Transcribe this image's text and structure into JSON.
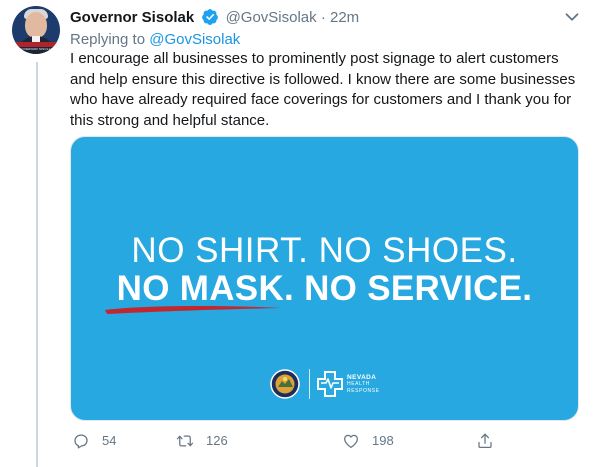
{
  "tweet": {
    "author_name": "Governor Sisolak",
    "author_handle": "@GovSisolak",
    "separator": "·",
    "time": "22m",
    "reply_prefix": "Replying to",
    "reply_to": "@GovSisolak",
    "text": "I encourage all businesses to prominently post signage to alert customers and help ensure this directive is followed. I know there are some businesses who have already required face coverings for customers and I thank you for this strong and helpful stance.",
    "avatar_ribbon_text": "GOVERNOR SISOLAK"
  },
  "media": {
    "line1": "NO SHIRT. NO SHOES.",
    "line2": "NO MASK. NO SERVICE.",
    "logo_title": "NEVADA",
    "logo_sub1": "HEALTH",
    "logo_sub2": "RESPONSE"
  },
  "actions": {
    "reply_count": "54",
    "retweet_count": "126",
    "like_count": "198"
  },
  "icons": {
    "verified": "verified-badge-icon",
    "more": "chevron-down-icon",
    "reply": "reply-icon",
    "retweet": "retweet-icon",
    "like": "heart-icon",
    "share": "share-icon"
  },
  "colors": {
    "link": "#1b95e0",
    "secondary_text": "#657786",
    "media_background": "#27a8e0",
    "underline_accent": "#c1272d"
  }
}
